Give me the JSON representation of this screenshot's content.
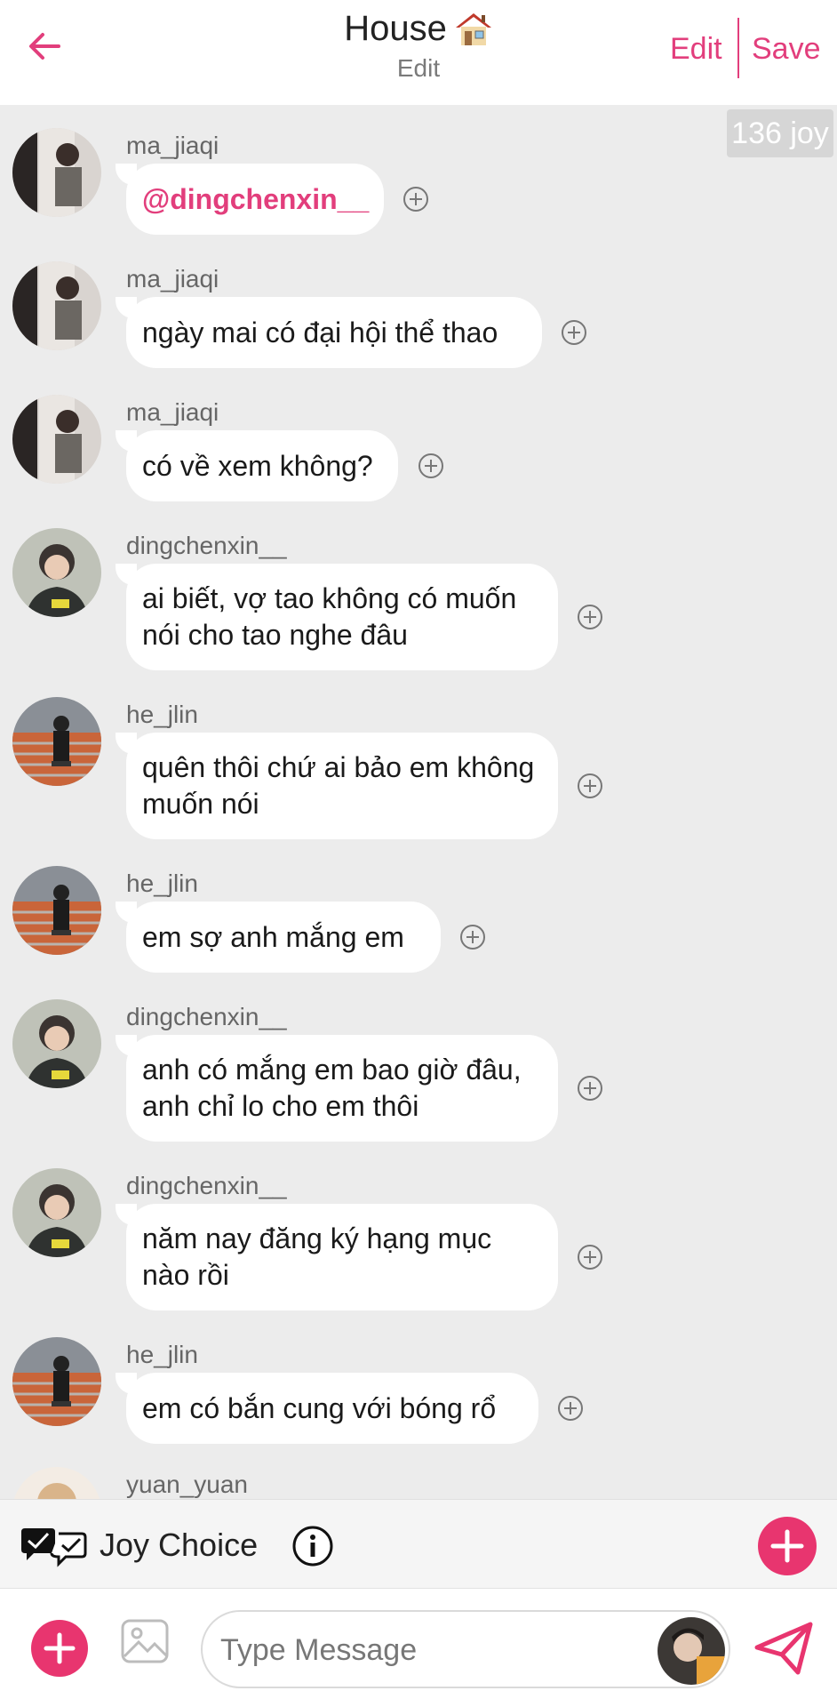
{
  "header": {
    "title": "House",
    "title_icon": "house-emoji-icon",
    "subtitle": "Edit",
    "edit_label": "Edit",
    "save_label": "Save",
    "accent_color": "#e23e7c"
  },
  "joy_badge": "136 joy",
  "messages": [
    {
      "user": "ma_jiaqi",
      "text": "@dingchenxin__",
      "mention": true
    },
    {
      "user": "ma_jiaqi",
      "text": "ngày mai có đại hội thể thao"
    },
    {
      "user": "ma_jiaqi",
      "text": "có về xem không?"
    },
    {
      "user": "dingchenxin__",
      "text": "ai biết, vợ tao không có muốn nói cho tao nghe đâu"
    },
    {
      "user": "he_jlin",
      "text": "quên thôi chứ ai bảo em không muốn nói"
    },
    {
      "user": "he_jlin",
      "text": "em sợ anh mắng em"
    },
    {
      "user": "dingchenxin__",
      "text": "anh có mắng em bao giờ đâu, anh chỉ lo cho em thôi"
    },
    {
      "user": "dingchenxin__",
      "text": "năm nay đăng ký hạng mục nào rồi"
    },
    {
      "user": "he_jlin",
      "text": "em có bắn cung với bóng rổ"
    },
    {
      "user": "yuan_yuan",
      "text": ""
    }
  ],
  "joy_choice": {
    "label": "Joy Choice",
    "icon": "double-check-bubble-icon",
    "info_icon": "info-icon"
  },
  "composer": {
    "placeholder": "Type Message",
    "value": ""
  }
}
